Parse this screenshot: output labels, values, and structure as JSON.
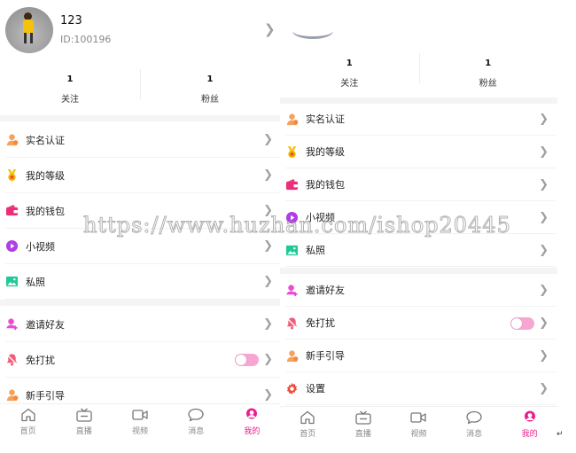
{
  "profile": {
    "nickname": "123",
    "user_id": "ID:100196"
  },
  "stats": [
    {
      "count": "1",
      "label": "关注"
    },
    {
      "count": "1",
      "label": "粉丝"
    }
  ],
  "left_menu_group1": [
    {
      "icon": "verify-person-icon",
      "label": "实名认证"
    },
    {
      "icon": "medal-icon",
      "label": "我的等级"
    },
    {
      "icon": "wallet-icon",
      "label": "我的钱包"
    },
    {
      "icon": "play-circle-icon",
      "label": "小视频"
    },
    {
      "icon": "image-icon",
      "label": "私照"
    }
  ],
  "left_menu_group2": [
    {
      "icon": "invite-friend-icon",
      "label": "邀请好友"
    },
    {
      "icon": "bell-mute-icon",
      "label": "免打扰"
    },
    {
      "icon": "guide-person-icon",
      "label": "新手引导"
    }
  ],
  "right_menu_group1": [
    {
      "icon": "verify-person-icon",
      "label": "实名认证"
    },
    {
      "icon": "medal-icon",
      "label": "我的等级"
    },
    {
      "icon": "wallet-icon",
      "label": "我的钱包"
    },
    {
      "icon": "play-circle-icon",
      "label": "小视频"
    },
    {
      "icon": "image-icon",
      "label": "私照"
    }
  ],
  "right_menu_group2": [
    {
      "icon": "invite-friend-icon",
      "label": "邀请好友"
    },
    {
      "icon": "bell-mute-icon",
      "label": "免打扰"
    },
    {
      "icon": "guide-person-icon",
      "label": "新手引导"
    },
    {
      "icon": "gear-icon",
      "label": "设置"
    }
  ],
  "do_not_disturb": {
    "enabled": true
  },
  "tabs": [
    {
      "icon": "home-icon",
      "label": "首页"
    },
    {
      "icon": "tv-icon",
      "label": "直播"
    },
    {
      "icon": "video-camera-icon",
      "label": "视频"
    },
    {
      "icon": "chat-bubble-icon",
      "label": "消息"
    },
    {
      "icon": "profile-icon",
      "label": "我的",
      "active": true
    }
  ],
  "colors": {
    "accent": "#e91e8c",
    "toggle_on": "#f7a6d3",
    "icon_orange": "#f5a25d",
    "icon_pink": "#e94ad6",
    "icon_teal": "#20c997",
    "icon_purple": "#b03ee6"
  },
  "watermark": "https://www.huzhan.com/ishop20445",
  "corner_mark": "↵"
}
